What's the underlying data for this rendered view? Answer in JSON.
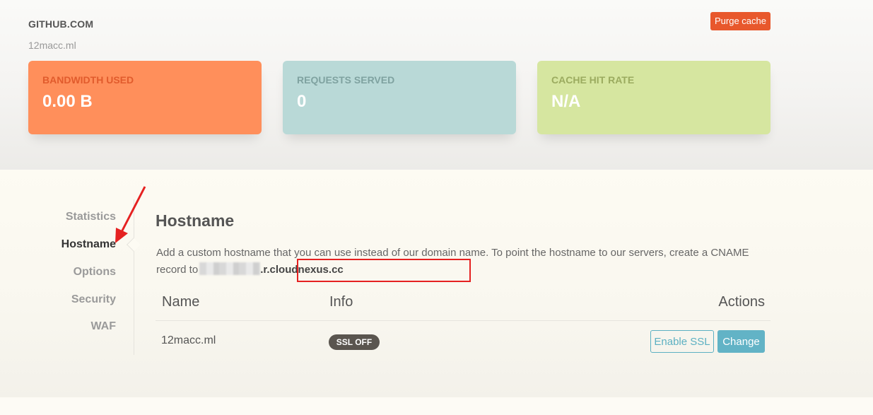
{
  "header": {
    "title": "GITHUB.COM",
    "domain": "12macc.ml",
    "purge_label": "Purge cache"
  },
  "stats": [
    {
      "label": "BANDWIDTH USED",
      "value": "0.00 B",
      "color": "#ff8f5b"
    },
    {
      "label": "REQUESTS SERVED",
      "value": "0",
      "color": "#b9d9d7"
    },
    {
      "label": "CACHE HIT RATE",
      "value": "N/A",
      "color": "#d6e6a0"
    }
  ],
  "sidebar": {
    "items": [
      {
        "label": "Statistics",
        "active": false
      },
      {
        "label": "Hostname",
        "active": true
      },
      {
        "label": "Options",
        "active": false
      },
      {
        "label": "Security",
        "active": false
      },
      {
        "label": "WAF",
        "active": false
      }
    ]
  },
  "hostname": {
    "title": "Hostname",
    "description": "Add a custom hostname that you can use instead of our domain name. To point the hostname to our servers, create a CNAME record to",
    "cname_target": ".r.cloudnexus.cc",
    "table": {
      "headers": [
        "Name",
        "Info",
        "Actions"
      ],
      "rows": [
        {
          "name": "12macc.ml",
          "badge": "SSL OFF",
          "enable_label": "Enable SSL",
          "change_label": "Change"
        }
      ]
    }
  },
  "colors": {
    "accent": "#e8582c",
    "action": "#62b3c6",
    "annotation": "#e52121"
  }
}
